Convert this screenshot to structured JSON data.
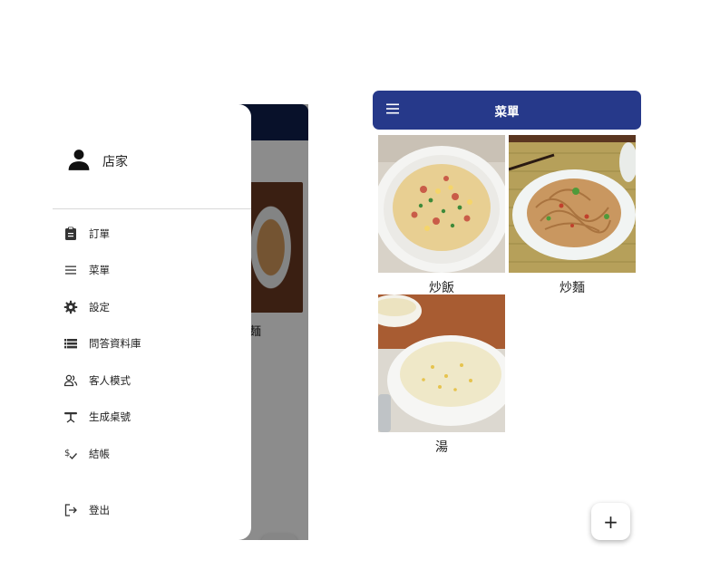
{
  "left_screen": {
    "drawer": {
      "user": {
        "icon": "person-icon",
        "name": "店家"
      },
      "items": [
        {
          "icon": "clipboard-icon",
          "label": "訂單"
        },
        {
          "icon": "menu-lines-icon",
          "label": "菜單"
        },
        {
          "icon": "gear-icon",
          "label": "設定"
        },
        {
          "icon": "list-database-icon",
          "label": "問答資料庫"
        },
        {
          "icon": "people-icon",
          "label": "客人模式"
        },
        {
          "icon": "table-icon",
          "label": "生成桌號"
        },
        {
          "icon": "price-check-icon",
          "label": "結帳"
        },
        {
          "icon": "logout-icon",
          "label": "登出"
        }
      ]
    },
    "background": {
      "food_label_fragment": "麵",
      "fab_label": "+"
    }
  },
  "right_screen": {
    "appbar": {
      "title": "菜單",
      "menu_icon": "hamburger-icon",
      "color": "#26398a"
    },
    "dishes": [
      {
        "name": "炒飯",
        "image": "fried-rice-photo"
      },
      {
        "name": "炒麵",
        "image": "fried-noodles-photo"
      },
      {
        "name": "湯",
        "image": "corn-soup-photo"
      }
    ],
    "fab_label": "+"
  }
}
